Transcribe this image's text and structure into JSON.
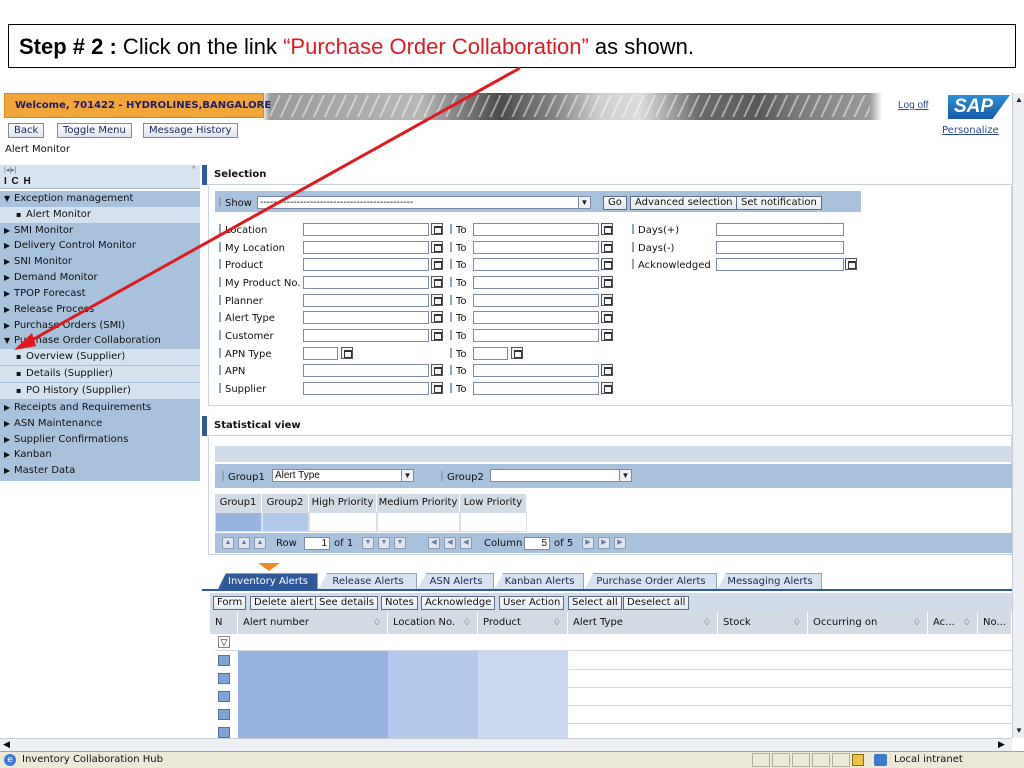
{
  "caption": {
    "step": "Step # 2 :",
    "before": " Click on the link ",
    "link": "“Purchase Order Collaboration”",
    "after": " as shown."
  },
  "header": {
    "welcome": "Welcome, 701422 - HYDROLINES,BANGALORE",
    "logoff": "Log off",
    "logo": "SAP",
    "personalize": "Personalize"
  },
  "toolbar": {
    "back": "Back",
    "toggle_menu": "Toggle Menu",
    "message_history": "Message History"
  },
  "page_title": "Alert Monitor",
  "sidebar": {
    "mini_controls": "|◂|▸|",
    "title": "I C H",
    "items": [
      {
        "label": "Exception management",
        "marker": "▼"
      },
      {
        "label": "Alert Monitor",
        "marker": "▪"
      },
      {
        "label": "SMI Monitor",
        "marker": "▶"
      },
      {
        "label": "Delivery Control Monitor",
        "marker": "▶"
      },
      {
        "label": "SNI Monitor",
        "marker": "▶"
      },
      {
        "label": "Demand Monitor",
        "marker": "▶"
      },
      {
        "label": "TPOP Forecast",
        "marker": "▶"
      },
      {
        "label": "Release Process",
        "marker": "▶"
      },
      {
        "label": "Purchase Orders (SMI)",
        "marker": "▶"
      },
      {
        "label": "Purchase Order Collaboration",
        "marker": "▼"
      },
      {
        "label": "Overview (Supplier)",
        "marker": "▪"
      },
      {
        "label": "Details (Supplier)",
        "marker": "▪"
      },
      {
        "label": "PO History (Supplier)",
        "marker": "▪"
      },
      {
        "label": "Receipts and Requirements",
        "marker": "▶"
      },
      {
        "label": "ASN Maintenance",
        "marker": "▶"
      },
      {
        "label": "Supplier Confirmations",
        "marker": "▶"
      },
      {
        "label": "Kanban",
        "marker": "▶"
      },
      {
        "label": "Master Data",
        "marker": "▶"
      }
    ]
  },
  "selection": {
    "title": "Selection",
    "show_label": "Show",
    "show_value": "----------------------------------------------",
    "go": "Go",
    "advanced": "Advanced selection",
    "set_notification": "Set notification",
    "to_label": "To",
    "fields": [
      "Location",
      "My Location",
      "Product",
      "My Product No.",
      "Planner",
      "Alert Type",
      "Customer",
      "APN Type",
      "APN",
      "Supplier"
    ],
    "right_fields": [
      "Days(+)",
      "Days(-)",
      "Acknowledged"
    ]
  },
  "stat": {
    "title": "Statistical view",
    "group1_label": "Group1",
    "group1_value": "Alert Type",
    "group2_label": "Group2",
    "group2_value": "",
    "columns": [
      "Group1",
      "Group2",
      "High Priority",
      "Medium Priority",
      "Low Priority"
    ],
    "row_label": "Row",
    "row_value": "1",
    "row_of": "of 1",
    "column_label": "Column",
    "column_value": "5",
    "column_of": "of 5"
  },
  "tabs": [
    "Inventory Alerts",
    "Release Alerts",
    "ASN Alerts",
    "Kanban Alerts",
    "Purchase Order Alerts",
    "Messaging Alerts"
  ],
  "grid": {
    "buttons": [
      "Form",
      "Delete alert",
      "See details",
      "Notes",
      "Acknowledge",
      "User Action",
      "Select all",
      "Deselect all"
    ],
    "columns": [
      "N",
      "Alert number",
      "Location No.",
      "Product",
      "Alert Type",
      "Stock",
      "Occurring on",
      "Ac...",
      "No..."
    ],
    "filter_icon": "filter-icon"
  },
  "statusbar": {
    "title": "Inventory Collaboration Hub",
    "zone": "Local intranet"
  },
  "colors": {
    "arrow": "#e0191f",
    "nav_bg": "#a8c1dc",
    "accent": "#2e5a9c",
    "welcome_bg": "#f2a63a"
  }
}
